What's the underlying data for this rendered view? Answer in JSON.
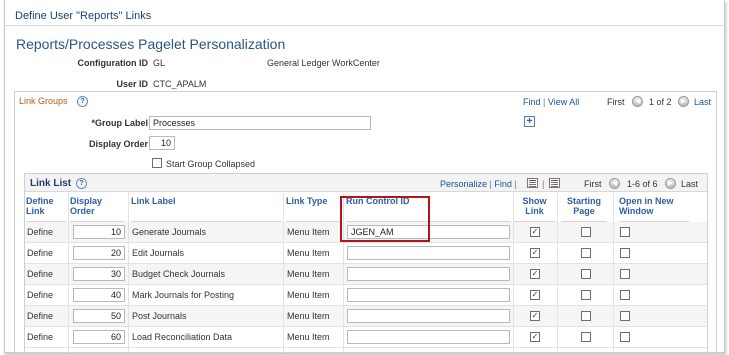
{
  "window_title": "Define User \"Reports\" Links",
  "page_title": "Reports/Processes Pagelet Personalization",
  "config": {
    "label": "Configuration ID",
    "value": "GL",
    "description": "General Ledger WorkCenter"
  },
  "user": {
    "label": "User ID",
    "value": "CTC_APALM"
  },
  "link_groups": {
    "title": "Link Groups",
    "find": "Find",
    "view_all": "View All",
    "first": "First",
    "pager": "1 of 2",
    "last": "Last",
    "group_label_label": "*Group Label",
    "group_label_value": "Processes",
    "display_order_label": "Display Order",
    "display_order_value": "10",
    "collapsed_label": "Start Group Collapsed",
    "collapsed_checked": false
  },
  "link_list": {
    "title": "Link List",
    "personalize": "Personalize",
    "find": "Find",
    "first": "First",
    "pager": "1-6 of 6",
    "last": "Last",
    "columns": {
      "define_link": "Define Link",
      "display_order": "Display Order",
      "link_label": "Link Label",
      "link_type": "Link Type",
      "run_control_id": "Run Control ID",
      "show_link": "Show Link",
      "starting_page": "Starting Page",
      "open_new_window": "Open in New Window"
    },
    "rows": [
      {
        "define": "Define",
        "order": "10",
        "label": "Generate Journals",
        "type": "Menu Item",
        "run_control": "JGEN_AM",
        "show": true,
        "start": false,
        "new_window": false
      },
      {
        "define": "Define",
        "order": "20",
        "label": "Edit Journals",
        "type": "Menu Item",
        "run_control": "",
        "show": true,
        "start": false,
        "new_window": false
      },
      {
        "define": "Define",
        "order": "30",
        "label": "Budget Check Journals",
        "type": "Menu Item",
        "run_control": "",
        "show": true,
        "start": false,
        "new_window": false
      },
      {
        "define": "Define",
        "order": "40",
        "label": "Mark Journals for Posting",
        "type": "Menu Item",
        "run_control": "",
        "show": true,
        "start": false,
        "new_window": false
      },
      {
        "define": "Define",
        "order": "50",
        "label": "Post Journals",
        "type": "Menu Item",
        "run_control": "",
        "show": true,
        "start": false,
        "new_window": false
      },
      {
        "define": "Define",
        "order": "60",
        "label": "Load Reconciliation Data",
        "type": "Menu Item",
        "run_control": "",
        "show": true,
        "start": false,
        "new_window": false
      }
    ]
  },
  "colors": {
    "title_blue": "#2a5585",
    "link_blue": "#1f4f9f",
    "group_orange": "#b35a12",
    "highlight_red": "#b5121b"
  }
}
